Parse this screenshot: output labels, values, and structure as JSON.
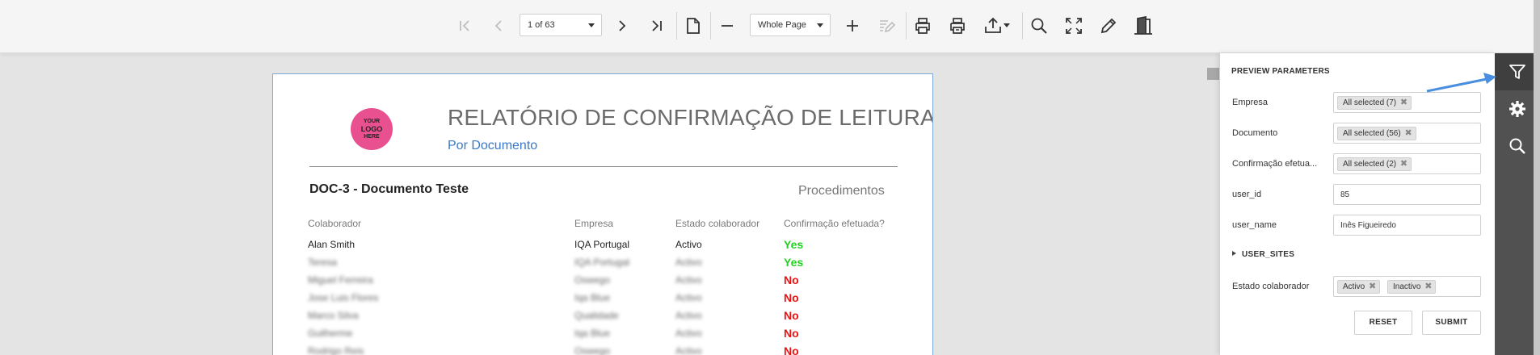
{
  "toolbar": {
    "page_select": "1 of 63",
    "zoom_select": "Whole Page"
  },
  "report": {
    "logo_lines": [
      "YOUR",
      "LOGO",
      "HERE"
    ],
    "title": "RELATÓRIO DE CONFIRMAÇÃO DE LEITURA",
    "subtitle": "Por Documento",
    "document": "DOC-3 - Documento Teste",
    "category": "Procedimentos",
    "columns": [
      "Colaborador",
      "Empresa",
      "Estado colaborador",
      "Confirmação efetuada?"
    ],
    "rows": [
      {
        "colaborador": "Alan Smith",
        "empresa": "IQA Portugal",
        "estado": "Activo",
        "confirmacao": "Yes"
      },
      {
        "colaborador": "Teresa",
        "empresa": "IQA Portugal",
        "estado": "Activo",
        "confirmacao": "Yes"
      },
      {
        "colaborador": "Miguel Ferreira",
        "empresa": "Oswego",
        "estado": "Activo",
        "confirmacao": "No"
      },
      {
        "colaborador": "Jose Luis Flores",
        "empresa": "Iqa Blue",
        "estado": "Activo",
        "confirmacao": "No"
      },
      {
        "colaborador": "Marco Silva",
        "empresa": "Qualidade",
        "estado": "Activo",
        "confirmacao": "No"
      },
      {
        "colaborador": "Guilherme",
        "empresa": "Iqa Blue",
        "estado": "Activo",
        "confirmacao": "No"
      },
      {
        "colaborador": "Rodrigo Reis",
        "empresa": "Oswego",
        "estado": "Activo",
        "confirmacao": "No"
      }
    ]
  },
  "panel": {
    "title": "PREVIEW PARAMETERS",
    "params": {
      "empresa": {
        "label": "Empresa",
        "chip": "All selected (7)"
      },
      "documento": {
        "label": "Documento",
        "chip": "All selected (56)"
      },
      "confirmacao": {
        "label": "Confirmação efetua...",
        "chip": "All selected (2)"
      },
      "user_id": {
        "label": "user_id",
        "value": "85"
      },
      "user_name": {
        "label": "user_name",
        "value": "Inês Figueiredo"
      },
      "estado": {
        "label": "Estado colaborador",
        "chips": [
          "Activo",
          "Inactivo"
        ]
      }
    },
    "section": "USER_SITES",
    "reset_label": "RESET",
    "submit_label": "SUBMIT"
  },
  "colors": {
    "accent_blue": "#3a79c8",
    "yes_green": "#22d022",
    "no_red": "#e81313",
    "rail_bg": "#515151",
    "arrow_blue": "#4a8ee0"
  }
}
